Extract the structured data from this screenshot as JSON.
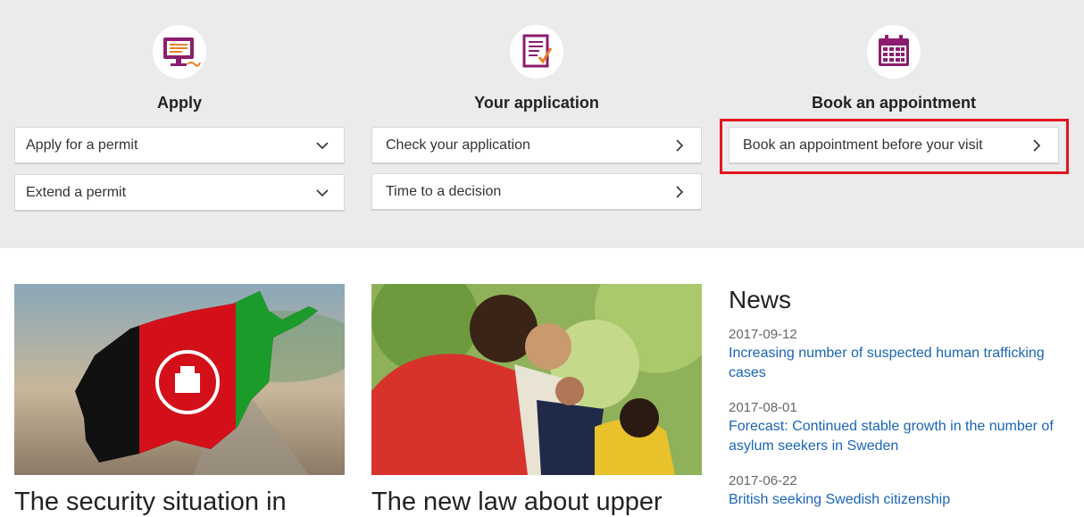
{
  "sections": {
    "apply": {
      "title": "Apply",
      "icon": "computer-screen-icon",
      "links": [
        "Apply for a permit",
        "Extend a permit"
      ]
    },
    "your_application": {
      "title": "Your application",
      "icon": "checklist-document-icon",
      "links": [
        "Check your application",
        "Time to a decision"
      ]
    },
    "book": {
      "title": "Book an appointment",
      "icon": "calendar-icon",
      "links": [
        "Book an appointment before your visit"
      ]
    }
  },
  "cards": [
    {
      "title": "The security situation in"
    },
    {
      "title": "The new law about upper"
    }
  ],
  "news": {
    "heading": "News",
    "items": [
      {
        "date": "2017-09-12",
        "text": "Increasing number of suspected human trafficking cases"
      },
      {
        "date": "2017-08-01",
        "text": "Forecast: Continued stable growth in the number of asylum seekers in Sweden"
      },
      {
        "date": "2017-06-22",
        "text": "British seeking Swedish citizenship"
      }
    ]
  },
  "colors": {
    "band": "#ebebeb",
    "accent_purple": "#8c1d6e",
    "accent_orange": "#e8822a",
    "link_blue": "#1a64b7",
    "highlight_red": "#e3151f"
  }
}
